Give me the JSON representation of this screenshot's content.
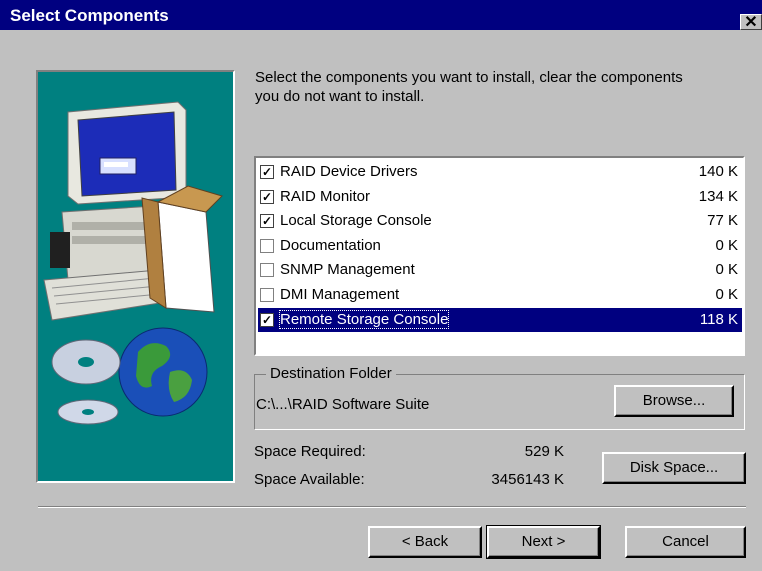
{
  "window": {
    "title": "Select Components",
    "close_glyph": "✕"
  },
  "instructions": "Select the components you want to install, clear the components you do not want to install.",
  "components": [
    {
      "label": "RAID Device Drivers",
      "size": "140 K",
      "checked": true,
      "selected": false
    },
    {
      "label": "RAID Monitor",
      "size": "134 K",
      "checked": true,
      "selected": false
    },
    {
      "label": "Local Storage Console",
      "size": "77 K",
      "checked": true,
      "selected": false
    },
    {
      "label": "Documentation",
      "size": "0 K",
      "checked": false,
      "selected": false
    },
    {
      "label": "SNMP Management",
      "size": "0 K",
      "checked": false,
      "selected": false
    },
    {
      "label": "DMI Management",
      "size": "0 K",
      "checked": false,
      "selected": false
    },
    {
      "label": "Remote Storage Console",
      "size": "118 K",
      "checked": true,
      "selected": true
    }
  ],
  "destination": {
    "group_label": "Destination Folder",
    "path": "C:\\...\\RAID Software Suite",
    "browse_label": "Browse..."
  },
  "space": {
    "required_label": "Space Required:",
    "required_value": "529 K",
    "available_label": "Space Available:",
    "available_value": "3456143 K",
    "disk_space_label": "Disk Space..."
  },
  "buttons": {
    "back": "< Back",
    "next": "Next >",
    "cancel": "Cancel"
  },
  "colors": {
    "titlebar": "#000080",
    "face": "#c0c0c0",
    "art_background": "#008080",
    "selection": "#000080"
  }
}
